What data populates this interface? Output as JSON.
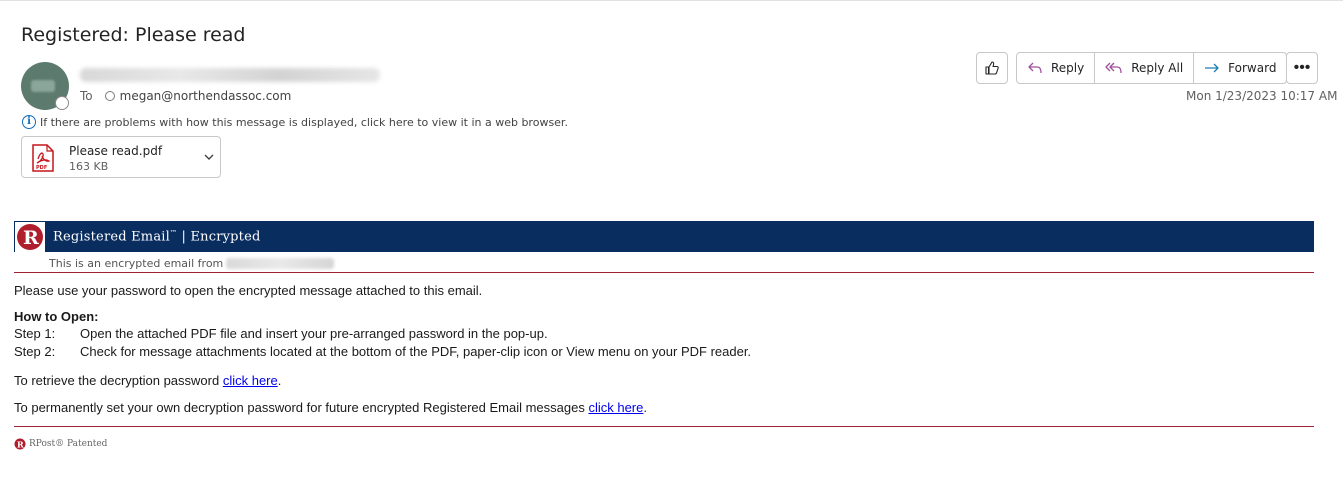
{
  "email": {
    "subject": "Registered: Please read",
    "to_label": "To",
    "to_address": "megan@northendassoc.com",
    "info_message": "If there are problems with how this message is displayed, click here to view it in a web browser.",
    "date": "Mon 1/23/2023 10:17 AM"
  },
  "attachment": {
    "name": "Please read.pdf",
    "size": "163 KB",
    "icon": "pdf-icon"
  },
  "actions": {
    "like_icon": "thumbs-up-icon",
    "reply": "Reply",
    "reply_all": "Reply All",
    "forward": "Forward",
    "more": "•••"
  },
  "body": {
    "banner_title_part1": "Registered Email",
    "banner_tm": "™",
    "banner_sep": " | ",
    "banner_title_part2": "Encrypted",
    "encrypted_from": "This is an encrypted email from",
    "instruction": "Please use your password to open the encrypted message attached to this email.",
    "how_to_open": "How to Open:",
    "steps": [
      {
        "label": "Step 1:",
        "text": "Open the attached PDF file and insert your pre-arranged password in the pop-up."
      },
      {
        "label": "Step 2:",
        "text": "Check for message attachments located at the bottom of the PDF, paper-clip icon or View menu on your PDF reader."
      }
    ],
    "retrieve_text": "To retrieve the decryption password ",
    "retrieve_link": "click here",
    "retrieve_end": ".",
    "permanent_text": "To permanently set your own decryption password for future encrypted Registered Email messages ",
    "permanent_link": "click here",
    "permanent_end": ".",
    "footer": "RPost® Patented"
  },
  "colors": {
    "banner": "#0a2d60",
    "rule": "#9b2335",
    "link": "#0000ee",
    "accent": "#0f6cbd"
  }
}
